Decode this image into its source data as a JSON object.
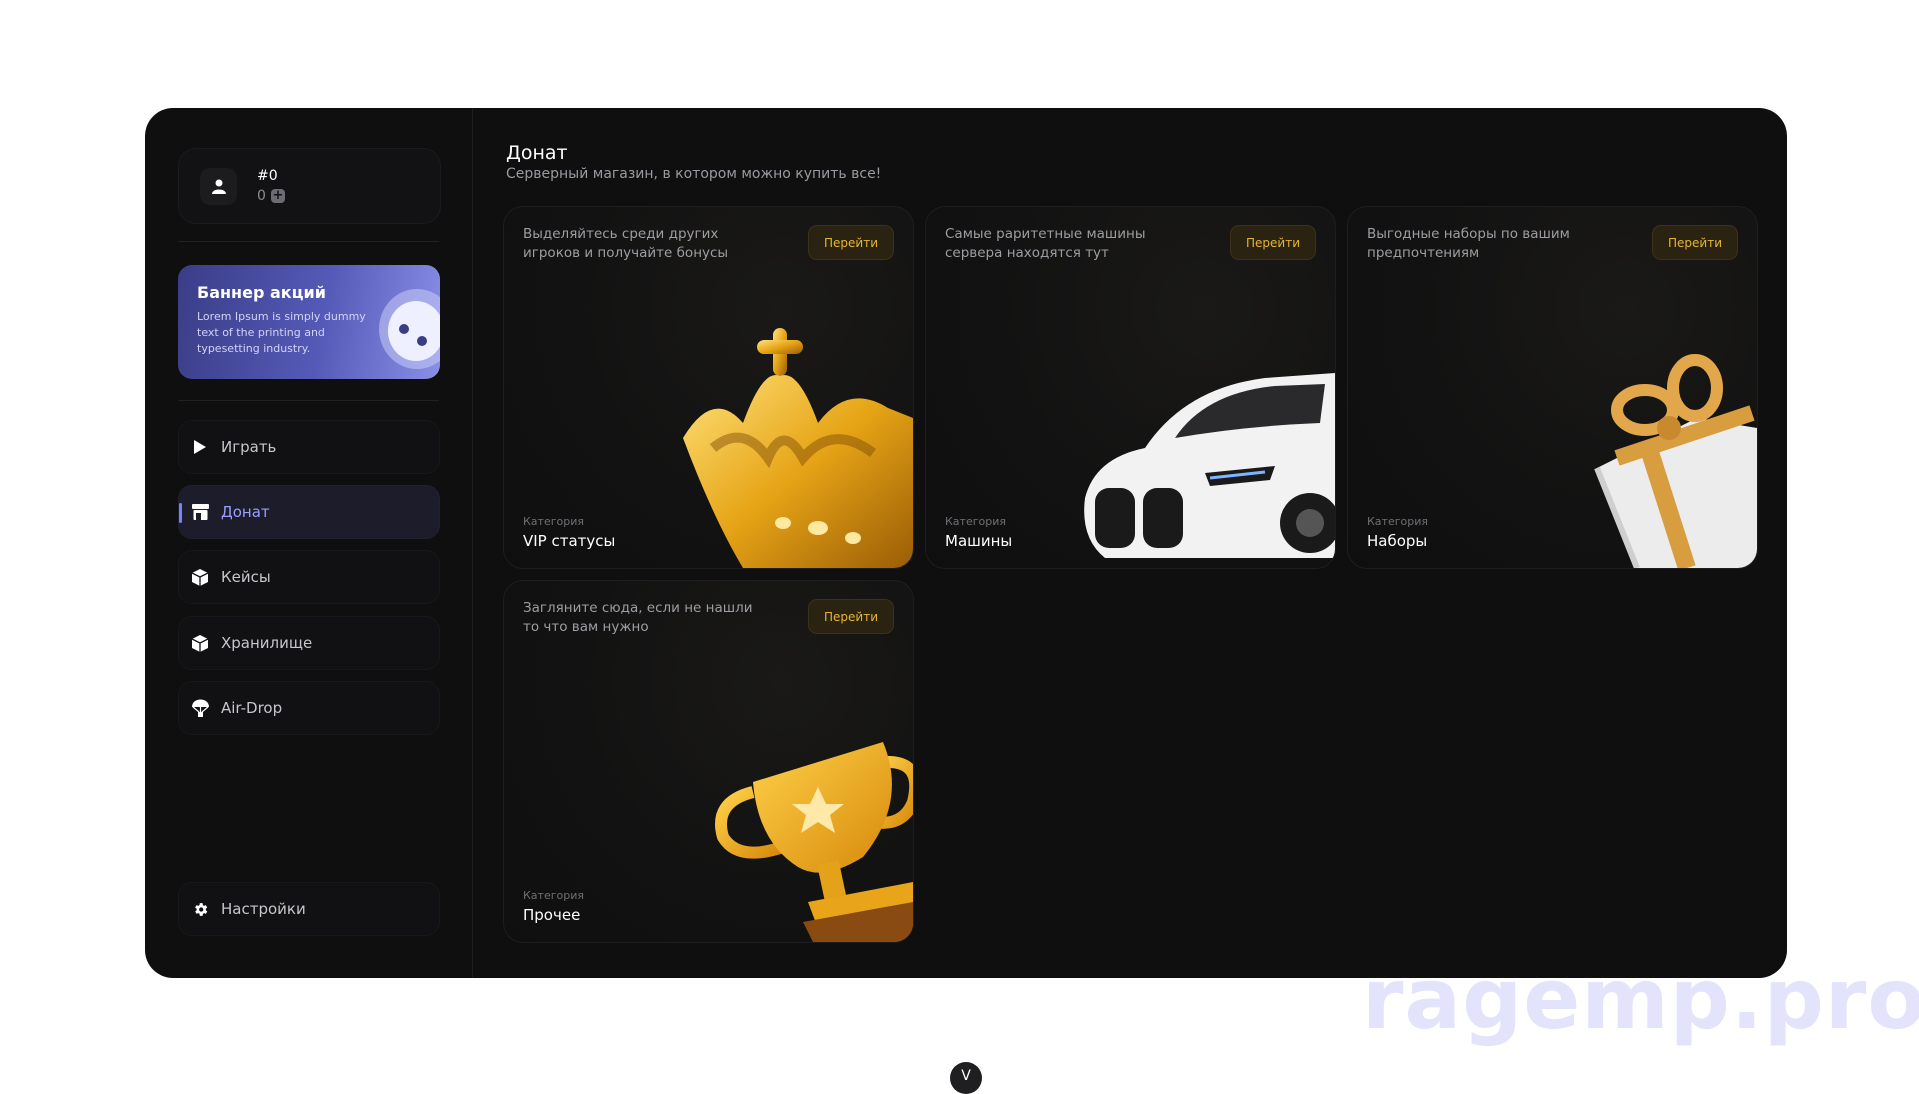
{
  "profile": {
    "id": "#0",
    "balance": "0",
    "plus_icon": "+"
  },
  "banner": {
    "title": "Баннер акций",
    "text": "Lorem Ipsum is simply dummy text of the printing and typesetting industry."
  },
  "nav": {
    "items": [
      {
        "label": "Играть",
        "icon": "play-icon"
      },
      {
        "label": "Донат",
        "icon": "store-icon",
        "active": true
      },
      {
        "label": "Кейсы",
        "icon": "box-icon"
      },
      {
        "label": "Хранилище",
        "icon": "box-icon"
      },
      {
        "label": "Air-Drop",
        "icon": "parachute-icon"
      }
    ],
    "settings": {
      "label": "Настройки",
      "icon": "gear-icon"
    }
  },
  "page": {
    "title": "Донат",
    "subtitle": "Серверный магазин, в котором можно купить все!"
  },
  "cards": [
    {
      "desc": "Выделяйтесь среди других игроков и получайте бонусы",
      "button": "Перейти",
      "category_label": "Категория",
      "name": "VIP статусы",
      "art": "crown"
    },
    {
      "desc": "Самые раритетные машины сервера находятся тут",
      "button": "Перейти",
      "category_label": "Категория",
      "name": "Машины",
      "art": "car"
    },
    {
      "desc": "Выгодные наборы по вашим предпочтениям",
      "button": "Перейти",
      "category_label": "Категория",
      "name": "Наборы",
      "art": "gift"
    },
    {
      "desc": "Загляните сюда, если не нашли то что вам нужно",
      "button": "Перейти",
      "category_label": "Категория",
      "name": "Прочее",
      "art": "trophy"
    }
  ],
  "watermark": "ragemp.pro",
  "bottom_icon": "chevron-down-icon",
  "bottom_glyph": "V",
  "colors": {
    "accent": "#7b80ff",
    "gold": "#e7b532",
    "background": "#0f0f10"
  }
}
